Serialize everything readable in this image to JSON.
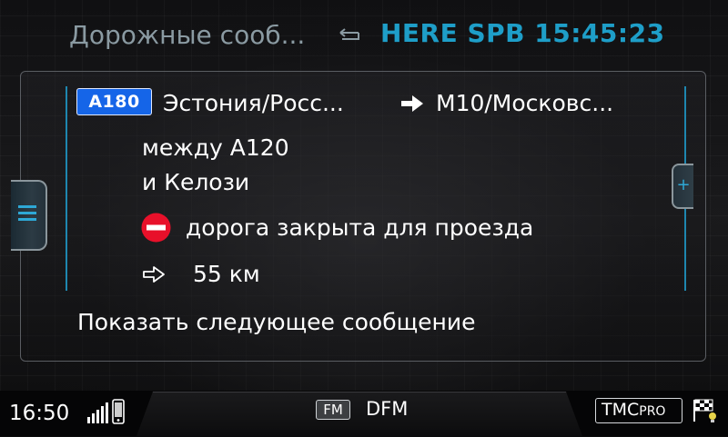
{
  "header": {
    "title": "Дорожные сооб...",
    "route_info": "HERE SPB 15:45:23"
  },
  "message": {
    "road_number": "A180",
    "from": "Эстония/Росс...",
    "to": "M10/Московс...",
    "between_line1": "между A120",
    "between_line2": "и Келози",
    "event": "дорога закрыта для проезда",
    "distance": "55 км"
  },
  "actions": {
    "next_message": "Показать следующее сообщение"
  },
  "status_bar": {
    "time": "16:50",
    "band": "FM",
    "station": "DFM",
    "tmc_label": "TMC",
    "tmc_pro": "PRO"
  },
  "colors": {
    "accent": "#1e9ec8",
    "road_badge": "#1565e8",
    "no_entry": "#e8102a"
  },
  "icons": {
    "back": "back-arrow-icon",
    "direction": "right-arrow-icon",
    "no_entry": "no-entry-icon",
    "distance": "outline-arrow-icon",
    "menu": "menu-icon",
    "expand": "plus-icon",
    "signal": "signal-bars-icon",
    "phone": "phone-icon",
    "traffic": "traffic-flag-icon"
  }
}
